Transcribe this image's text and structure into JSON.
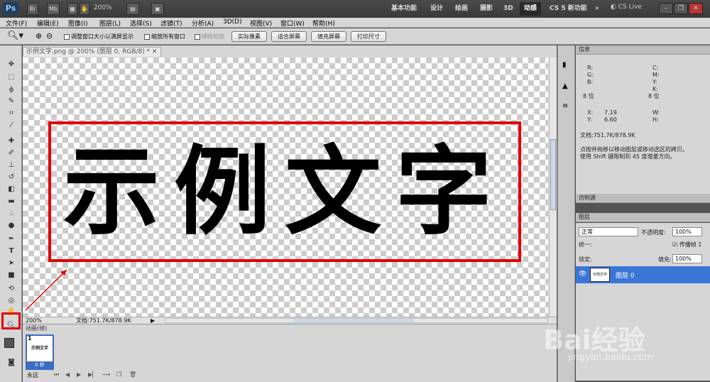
{
  "appbar": {
    "logo": "Ps",
    "buttons": [
      "Br",
      "Mb"
    ],
    "zoom": "200%",
    "workspaces": [
      "基本功能",
      "设计",
      "绘画",
      "摄影",
      "3D",
      "动感",
      "CS 5 新功能"
    ],
    "active_workspace": "动感",
    "more": "»",
    "cslive": "CS Live"
  },
  "menubar": {
    "items": [
      "文件(F)",
      "编辑(E)",
      "图像(I)",
      "图层(L)",
      "选择(S)",
      "滤镜(T)",
      "分析(A)",
      "3D(D)",
      "视图(V)",
      "窗口(W)",
      "帮助(H)"
    ]
  },
  "options": {
    "chk_resize": "调整窗口大小以满屏显示",
    "chk_all": "缩放所有窗口",
    "chk_scrub": "细微缩放",
    "btn_actual": "实际像素",
    "btn_fit": "适合屏幕",
    "btn_fill": "填充屏幕",
    "btn_print": "打印尺寸"
  },
  "document": {
    "tab_title": "示例文字.png @ 200% (图层 0, RGB/8) *",
    "canvas_text": "示例文字",
    "zoom": "200%",
    "doc_size": "文档:751.7K/878.9K"
  },
  "animation": {
    "tab": "动画(帧)",
    "frame_number": "1",
    "frame_time": "0 秒",
    "loop": "永远"
  },
  "info_panel": {
    "title": "信息",
    "r": "R:",
    "g": "G:",
    "b": "B:",
    "c": "C:",
    "m": "M:",
    "y": "Y:",
    "k": "K:",
    "bits_left": "8 位",
    "bits_right": "8 位",
    "x_label": "X:",
    "x_value": "7.19",
    "y_label": "Y:",
    "y_value": "6.60",
    "w_label": "W:",
    "h_label": "H:",
    "doc": "文档:751.7K/878.9K",
    "hint1": "点按并拖移以移动图层或移动选区的拷贝。",
    "hint2": "使用 Shift 键限制到 45 度增量方向。"
  },
  "clone_panel": {
    "title": "仿制源"
  },
  "layers_panel": {
    "title": "图层",
    "blend_mode": "正常",
    "opacity_label": "不透明度:",
    "opacity_value": "100%",
    "unify_label": "统一:",
    "propagate": "传播帧 1",
    "lock_label": "锁定:",
    "fill_label": "填充:",
    "fill_value": "100%",
    "layer_name": "图层 0"
  },
  "watermark": {
    "brand": "Bai经验",
    "url": "jingyan.baidu.com"
  },
  "colors": {
    "annotation_red": "#e00000",
    "selection_blue": "#3a76d8"
  }
}
